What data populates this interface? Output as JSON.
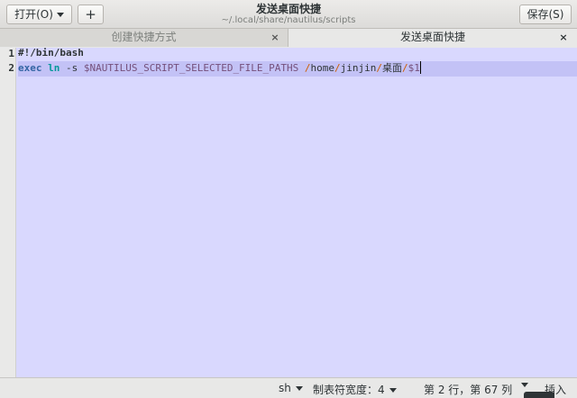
{
  "header": {
    "open_label": "打开(O)",
    "new_label": "+",
    "title": "发送桌面快捷",
    "subtitle": "~/.local/share/nautilus/scripts",
    "save_label": "保存(S)"
  },
  "tabs": [
    {
      "label": "创建快捷方式",
      "close": "×",
      "active": false
    },
    {
      "label": "发送桌面快捷",
      "close": "×",
      "active": true
    }
  ],
  "editor": {
    "line_numbers": [
      "1",
      "2"
    ],
    "line1": "#!/bin/bash",
    "line2": {
      "exec": "exec",
      "ln": "ln",
      "opt": " -s ",
      "var": "$NAUTILUS_SCRIPT_SELECTED_FILE_PATHS",
      "seg_home": "home",
      "seg_user": "jinjin",
      "seg_desktop": "桌面",
      "arg": "$1",
      "slash": "/"
    }
  },
  "statusbar": {
    "language": "sh",
    "tab_width": "制表符宽度：4",
    "position": "第 2 行，第 67 列",
    "mode": "插入"
  },
  "colors": {
    "editor_bg": "#d9d8fe",
    "current_line": "#c3c2f6",
    "keyword": "#3465a4",
    "variable": "#75507b"
  }
}
